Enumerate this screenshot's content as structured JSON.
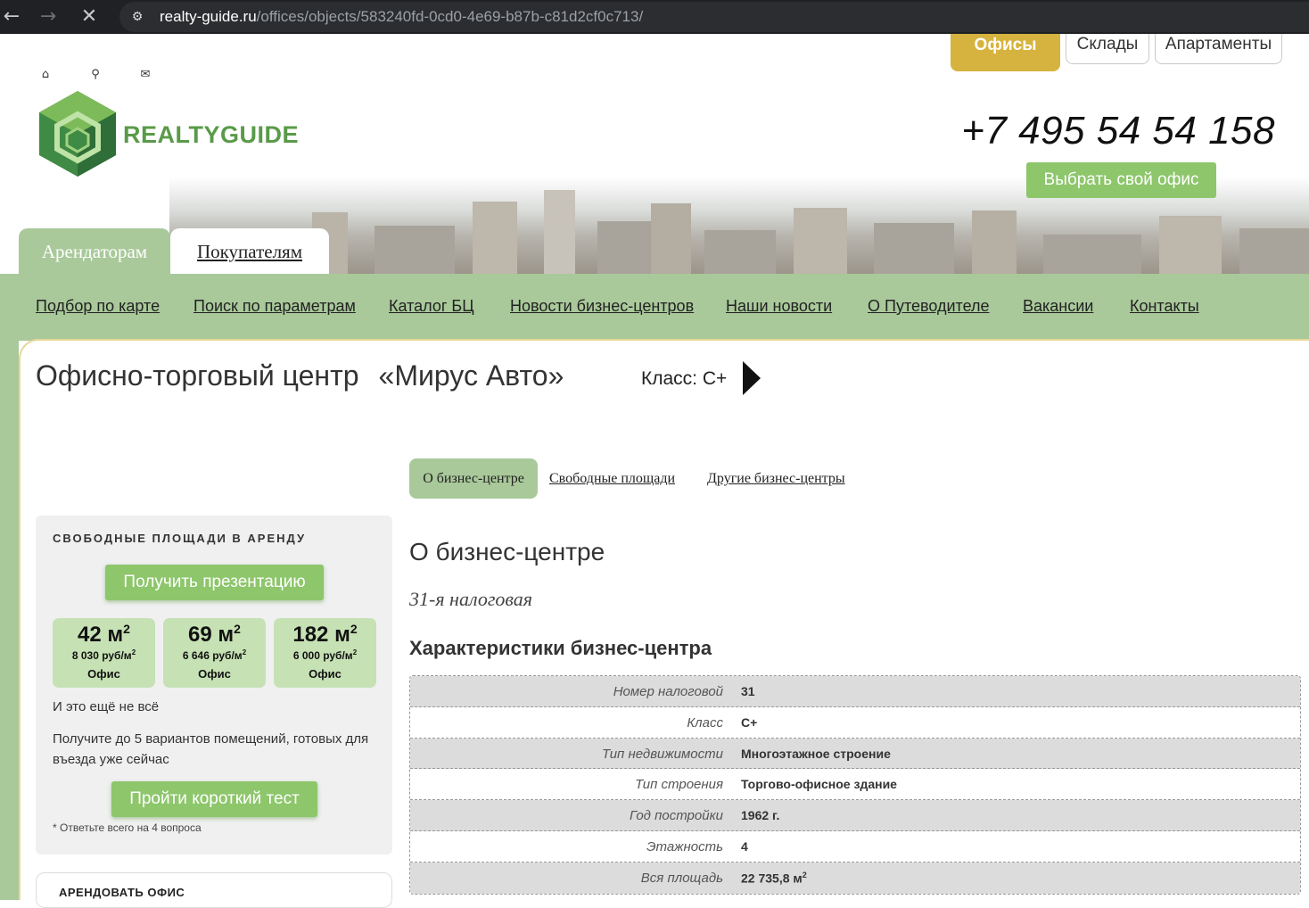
{
  "browser": {
    "url_host": "realty-guide.ru",
    "url_path": "/offices/objects/583240fd-0cd0-4e69-b87b-c81d2cf0c713/"
  },
  "header": {
    "logo_text": "REALTYGUIDE",
    "category_tabs": [
      {
        "label": "Офисы",
        "active": true
      },
      {
        "label": "Склады",
        "active": false
      },
      {
        "label": "Апартаменты",
        "active": false
      }
    ],
    "phone": "+7 495 54 54 158",
    "choose_office_label": "Выбрать свой офис",
    "audience_tabs": [
      {
        "label": "Арендаторам",
        "active": true
      },
      {
        "label": "Покупателям",
        "active": false
      }
    ]
  },
  "menu": {
    "items": [
      "Подбор по карте",
      "Поиск по параметрам",
      "Каталог БЦ",
      "Новости бизнес-центров",
      "Наши новости",
      "О Путеводителе",
      "Вакансии",
      "Контакты"
    ]
  },
  "building": {
    "type": "Офисно-торговый центр",
    "name": "«Мирус Авто»",
    "class_label": "Класс: С+"
  },
  "subtabs": [
    "О бизнес-центре",
    "Свободные площади",
    "Другие бизнес-центры"
  ],
  "widget": {
    "title": "СВОБОДНЫЕ ПЛОЩАДИ В АРЕНДУ",
    "presentation_label": "Получить презентацию",
    "areas": [
      {
        "size": "42 м",
        "price": "8 030 руб/м",
        "type": "Офис"
      },
      {
        "size": "69 м",
        "price": "6 646 руб/м",
        "type": "Офис"
      },
      {
        "size": "182 м",
        "price": "6 000 руб/м",
        "type": "Офис"
      }
    ],
    "more_text": "И это ещё не всё",
    "offer_text": "Получите до 5 вариантов помещений, готовых для въезда уже сейчас",
    "test_label": "Пройти короткий тест",
    "note": "* Ответьте всего на 4 вопроса"
  },
  "widget2": {
    "title": "АРЕНДОВАТЬ ОФИС"
  },
  "content": {
    "section_title": "О бизнес-центре",
    "district": "31-я налоговая",
    "characteristics_title": "Характеристики бизнес-центра",
    "characteristics": [
      {
        "label": "Номер налоговой",
        "value": "31"
      },
      {
        "label": "Класс",
        "value": "С+"
      },
      {
        "label": "Тип недвижимости",
        "value": "Многоэтажное строение"
      },
      {
        "label": "Тип строения",
        "value": "Торгово-офисное здание"
      },
      {
        "label": "Год постройки",
        "value": "1962 г."
      },
      {
        "label": "Этажность",
        "value": "4"
      },
      {
        "label": "Вся площадь",
        "value": "22 735,8 м"
      }
    ]
  }
}
